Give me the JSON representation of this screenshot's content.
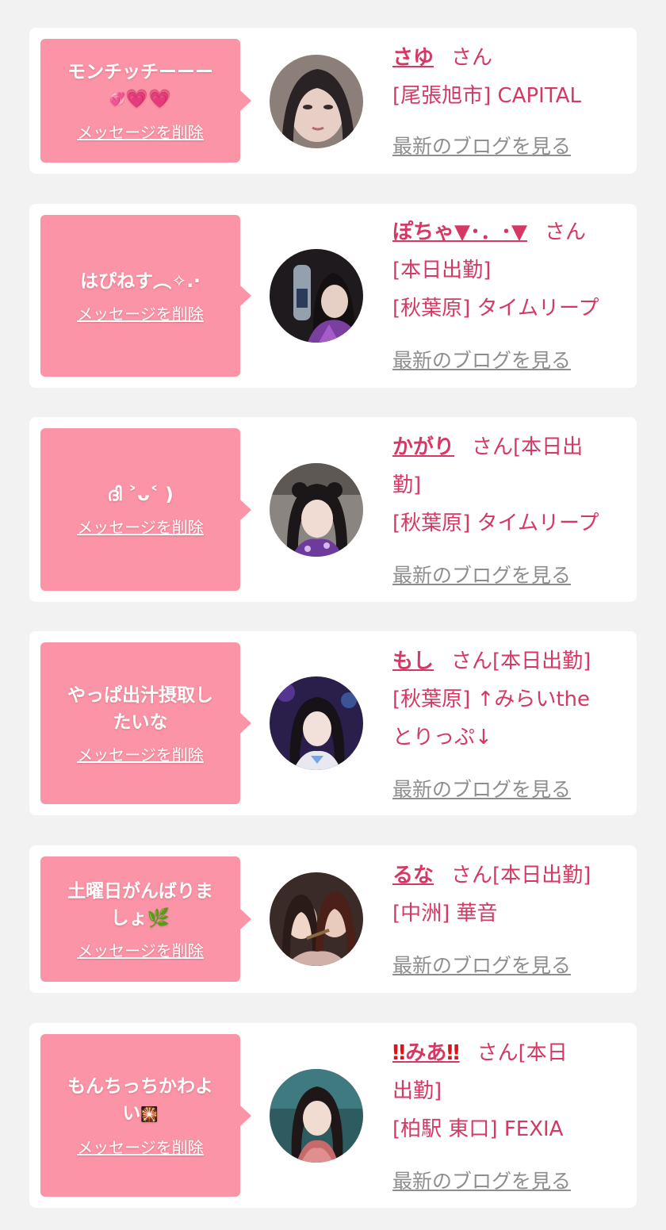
{
  "delete_label": "メッセージを削除",
  "blog_label": "最新のブログを見る",
  "san_label": "さん",
  "cards": [
    {
      "message_line1": "モンチッチーーー",
      "message_line2": "",
      "name": "さゆ",
      "info_line1": "[尾張旭市] CAPITAL",
      "info_line2": "",
      "info_line3": ""
    },
    {
      "message_line1": "はぴねす︵✧.·",
      "message_line2": "",
      "name": "ぽちゃ▼･．･▼",
      "info_line1": "[本日出勤]",
      "info_line2": "[秋葉原] タイムリープ",
      "info_line3": ""
    },
    {
      "message_line1": "ദി ˃ᴗ˂ )",
      "message_line2": "",
      "name": "かがり",
      "name_suffix": "さん[本日出",
      "info_line1": "勤]",
      "info_line2": "[秋葉原] タイムリープ",
      "info_line3": ""
    },
    {
      "message_line1": "やっぱ出汁摂取し",
      "message_line2": "たいな",
      "name": "もし",
      "name_suffix": "さん[本日出勤]",
      "info_line1": "[秋葉原] ↑みらいthe",
      "info_line2": "とりっぷ↓",
      "info_line3": ""
    },
    {
      "message_line1": "土曜日がんばりま",
      "message_line2": "しょ",
      "name": "るな",
      "name_suffix": "さん[本日出勤]",
      "info_line1": "[中洲] 華音",
      "info_line2": "",
      "info_line3": ""
    },
    {
      "message_line1": "もんちっちかわよ",
      "message_line2": "い",
      "name": "みあ",
      "name_mark": "‼",
      "name_suffix": "さん[本日",
      "info_line1": "出勤]",
      "info_line2": "[柏駅 東口] FEXIA",
      "info_line3": ""
    }
  ],
  "colors": {
    "background": "#f2f2f3",
    "card": "#ffffff",
    "bubble": "#fb94a6",
    "accent": "#d63864",
    "link_gray": "#8e8e8e"
  }
}
